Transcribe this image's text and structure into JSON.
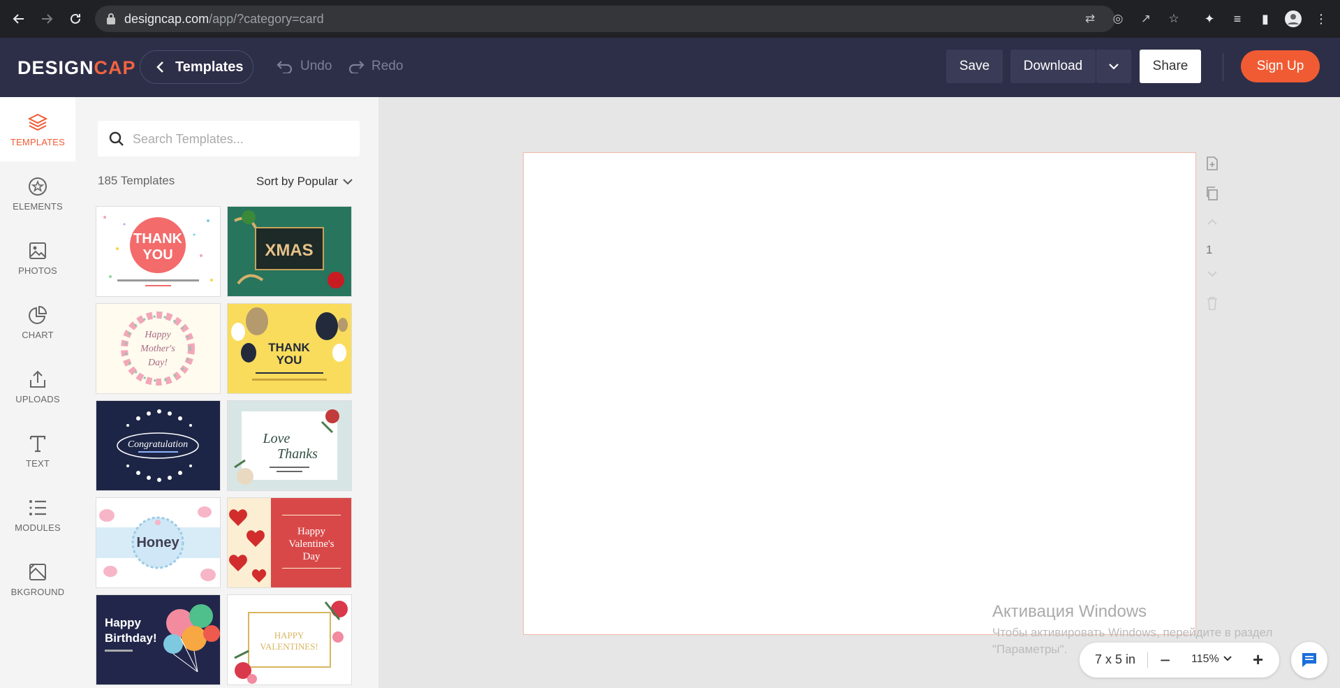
{
  "browser": {
    "url_host": "designcap.com",
    "url_path": "/app/?category=card"
  },
  "header": {
    "logo_main": "DESIGN",
    "logo_accent": "CAP",
    "templates_label": "Templates",
    "undo_label": "Undo",
    "redo_label": "Redo",
    "save_label": "Save",
    "download_label": "Download",
    "share_label": "Share",
    "signup_label": "Sign Up"
  },
  "rail": {
    "items": [
      {
        "label": "TEMPLATES",
        "icon": "layers-icon",
        "active": true
      },
      {
        "label": "ELEMENTS",
        "icon": "star-icon"
      },
      {
        "label": "PHOTOS",
        "icon": "image-icon"
      },
      {
        "label": "CHART",
        "icon": "pie-chart-icon"
      },
      {
        "label": "UPLOADS",
        "icon": "upload-icon"
      },
      {
        "label": "TEXT",
        "icon": "text-icon"
      },
      {
        "label": "MODULES",
        "icon": "list-icon"
      },
      {
        "label": "BKGROUND",
        "icon": "background-icon"
      }
    ]
  },
  "panel": {
    "search_placeholder": "Search Templates...",
    "count_label": "185 Templates",
    "sort_label": "Sort by Popular",
    "templates": [
      {
        "text1": "THANK",
        "text2": "YOU"
      },
      {
        "text1": "XMAS"
      },
      {
        "text1": "Happy",
        "text2": "Mother's",
        "text3": "Day!"
      },
      {
        "text1": "THANK",
        "text2": "YOU"
      },
      {
        "text1": "Congratulation"
      },
      {
        "text1": "Love",
        "text2": "Thanks"
      },
      {
        "text1": "Honey"
      },
      {
        "text1": "Happy",
        "text2": "Valentine's",
        "text3": "Day"
      },
      {
        "text1": "Happy",
        "text2": "Birthday!"
      },
      {
        "text1": "HAPPY",
        "text2": "VALENTINES!"
      }
    ]
  },
  "canvas": {
    "page_number": "1"
  },
  "zoom": {
    "size_label": "7 x 5 in",
    "minus": "−",
    "percent": "115%",
    "plus": "+"
  },
  "watermark": {
    "title": "Активация Windows",
    "subtitle": "Чтобы активировать Windows, перейдите в раздел \"Параметры\"."
  },
  "colors": {
    "header_bg": "#2d2f48",
    "accent": "#f05b33",
    "panel_bg": "#f4f4f4"
  }
}
